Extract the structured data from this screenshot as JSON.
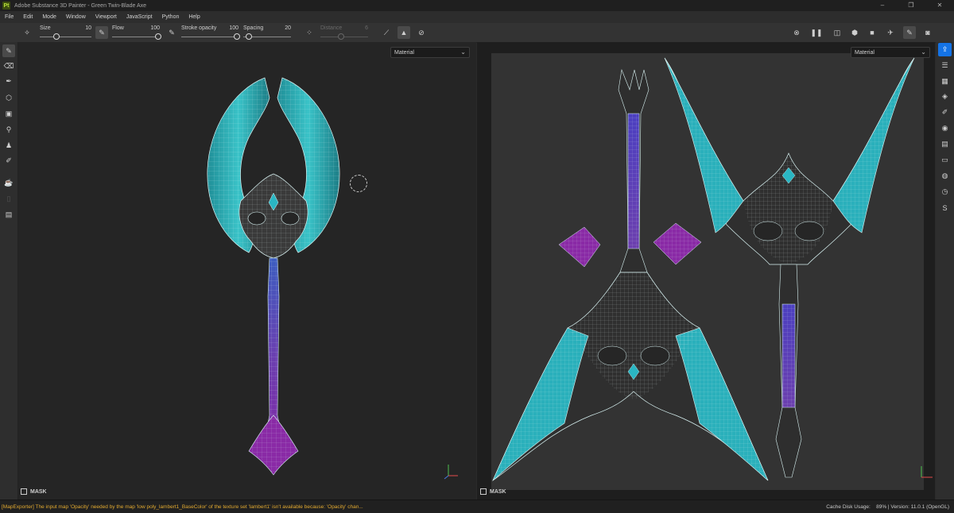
{
  "window": {
    "title": "Adobe Substance 3D Painter - Green Twin-Blade Axe",
    "controls": [
      "–",
      "❐",
      "✕"
    ]
  },
  "menu": [
    "File",
    "Edit",
    "Mode",
    "Window",
    "Viewport",
    "JavaScript",
    "Python",
    "Help"
  ],
  "toolbar": {
    "size": {
      "label": "Size",
      "value": "10"
    },
    "flow": {
      "label": "Flow",
      "value": "100"
    },
    "stroke_opacity": {
      "label": "Stroke opacity",
      "value": "100"
    },
    "spacing": {
      "label": "Spacing",
      "value": "20"
    },
    "distance": {
      "label": "Distance",
      "value": "6"
    }
  },
  "viewport3d": {
    "mode": "Material",
    "mask_label": "MASK"
  },
  "viewport2d": {
    "mode": "Material",
    "mask_label": "MASK"
  },
  "status": {
    "message": "[MapExporter] The input map 'Opacity' needed by the map 'low poly_lambert1_BaseColor' of the texture set 'lambert1' isn't available because: 'Opacity' chan...",
    "cache": "Cache Disk Usage:",
    "cache_value": "89% | Version: 11.0.1 (OpenGL)"
  },
  "colors": {
    "accent": "#1473e6",
    "warning": "#e1a930",
    "uv_teal": "#2fb7c0",
    "uv_purple": "#6a3fb0",
    "uv_magenta": "#9a2fa8"
  }
}
